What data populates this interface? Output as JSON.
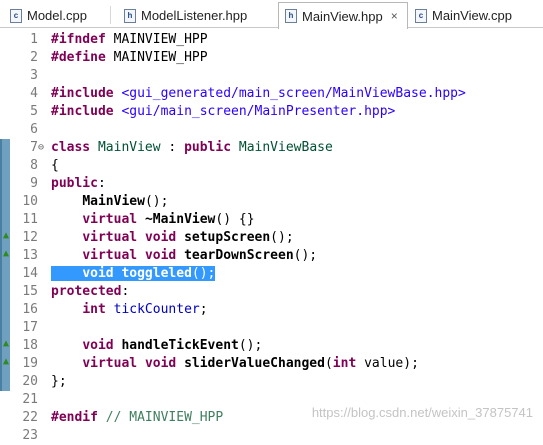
{
  "tabs": [
    {
      "label": "Model.cpp",
      "icon": "cpp-file-icon",
      "icon_text": "c",
      "active": false
    },
    {
      "label": "ModelListener.hpp",
      "icon": "header-file-icon",
      "icon_text": "h",
      "active": false
    },
    {
      "label": "MainView.hpp",
      "icon": "header-file-icon",
      "icon_text": "h",
      "active": true,
      "close": "×"
    },
    {
      "label": "MainView.cpp",
      "icon": "cpp-file-icon",
      "icon_text": "c",
      "active": false
    }
  ],
  "editor": {
    "lines": [
      {
        "n": "1",
        "t": [
          {
            "s": "#ifndef",
            "c": "kw"
          },
          {
            "s": " MAINVIEW_HPP"
          }
        ]
      },
      {
        "n": "2",
        "t": [
          {
            "s": "#define",
            "c": "kw"
          },
          {
            "s": " MAINVIEW_HPP"
          }
        ]
      },
      {
        "n": "3",
        "t": []
      },
      {
        "n": "4",
        "t": [
          {
            "s": "#include",
            "c": "kw"
          },
          {
            "s": " "
          },
          {
            "s": "<gui_generated/main_screen/MainViewBase.hpp>",
            "c": "str"
          }
        ]
      },
      {
        "n": "5",
        "t": [
          {
            "s": "#include",
            "c": "kw"
          },
          {
            "s": " "
          },
          {
            "s": "<gui/main_screen/MainPresenter.hpp>",
            "c": "str"
          }
        ]
      },
      {
        "n": "6",
        "t": []
      },
      {
        "n": "7",
        "fold": "⊖",
        "mark": true,
        "t": [
          {
            "s": "class",
            "c": "kw"
          },
          {
            "s": " "
          },
          {
            "s": "MainView",
            "c": "ty"
          },
          {
            "s": " : "
          },
          {
            "s": "public",
            "c": "kw"
          },
          {
            "s": " "
          },
          {
            "s": "MainViewBase",
            "c": "ty"
          }
        ]
      },
      {
        "n": "8",
        "mark": true,
        "t": [
          {
            "s": "{"
          }
        ]
      },
      {
        "n": "9",
        "mark": true,
        "t": [
          {
            "s": "public",
            "c": "kw"
          },
          {
            "s": ":"
          }
        ]
      },
      {
        "n": "10",
        "mark": true,
        "t": [
          {
            "s": "    "
          },
          {
            "s": "MainView",
            "c": "fn"
          },
          {
            "s": "();"
          }
        ]
      },
      {
        "n": "11",
        "mark": true,
        "t": [
          {
            "s": "    "
          },
          {
            "s": "virtual",
            "c": "kw"
          },
          {
            "s": " "
          },
          {
            "s": "~MainView",
            "c": "fn"
          },
          {
            "s": "() {}"
          }
        ]
      },
      {
        "n": "12",
        "mark": true,
        "ovr": "▲",
        "t": [
          {
            "s": "    "
          },
          {
            "s": "virtual",
            "c": "kw"
          },
          {
            "s": " "
          },
          {
            "s": "void",
            "c": "kw"
          },
          {
            "s": " "
          },
          {
            "s": "setupScreen",
            "c": "fn"
          },
          {
            "s": "();"
          }
        ]
      },
      {
        "n": "13",
        "mark": true,
        "ovr": "▲",
        "t": [
          {
            "s": "    "
          },
          {
            "s": "virtual",
            "c": "kw"
          },
          {
            "s": " "
          },
          {
            "s": "void",
            "c": "kw"
          },
          {
            "s": " "
          },
          {
            "s": "tearDownScreen",
            "c": "fn"
          },
          {
            "s": "();"
          }
        ]
      },
      {
        "n": "14",
        "mark": true,
        "sel": true,
        "t": [
          {
            "s": "    "
          },
          {
            "s": "void",
            "c": "kw"
          },
          {
            "s": " "
          },
          {
            "s": "toggleled",
            "c": "fn"
          },
          {
            "s": "();"
          }
        ]
      },
      {
        "n": "15",
        "mark": true,
        "t": [
          {
            "s": "protected",
            "c": "kw"
          },
          {
            "s": ":"
          }
        ]
      },
      {
        "n": "16",
        "mark": true,
        "t": [
          {
            "s": "    "
          },
          {
            "s": "int",
            "c": "kw"
          },
          {
            "s": " "
          },
          {
            "s": "tickCounter",
            "c": "fld"
          },
          {
            "s": ";"
          }
        ]
      },
      {
        "n": "17",
        "mark": true,
        "t": []
      },
      {
        "n": "18",
        "mark": true,
        "ovr": "▲",
        "t": [
          {
            "s": "    "
          },
          {
            "s": "void",
            "c": "kw"
          },
          {
            "s": " "
          },
          {
            "s": "handleTickEvent",
            "c": "fn"
          },
          {
            "s": "();"
          }
        ]
      },
      {
        "n": "19",
        "mark": true,
        "ovr": "▲",
        "t": [
          {
            "s": "    "
          },
          {
            "s": "virtual",
            "c": "kw"
          },
          {
            "s": " "
          },
          {
            "s": "void",
            "c": "kw"
          },
          {
            "s": " "
          },
          {
            "s": "sliderValueChanged",
            "c": "fn"
          },
          {
            "s": "("
          },
          {
            "s": "int",
            "c": "kw"
          },
          {
            "s": " value);"
          }
        ]
      },
      {
        "n": "20",
        "mark": true,
        "t": [
          {
            "s": "};"
          }
        ]
      },
      {
        "n": "21",
        "t": []
      },
      {
        "n": "22",
        "t": [
          {
            "s": "#endif",
            "c": "kw"
          },
          {
            "s": " "
          },
          {
            "s": "// MAINVIEW_HPP",
            "c": "cm"
          }
        ]
      },
      {
        "n": "23",
        "t": []
      }
    ]
  },
  "watermark": "https://blog.csdn.net/weixin_37875741"
}
